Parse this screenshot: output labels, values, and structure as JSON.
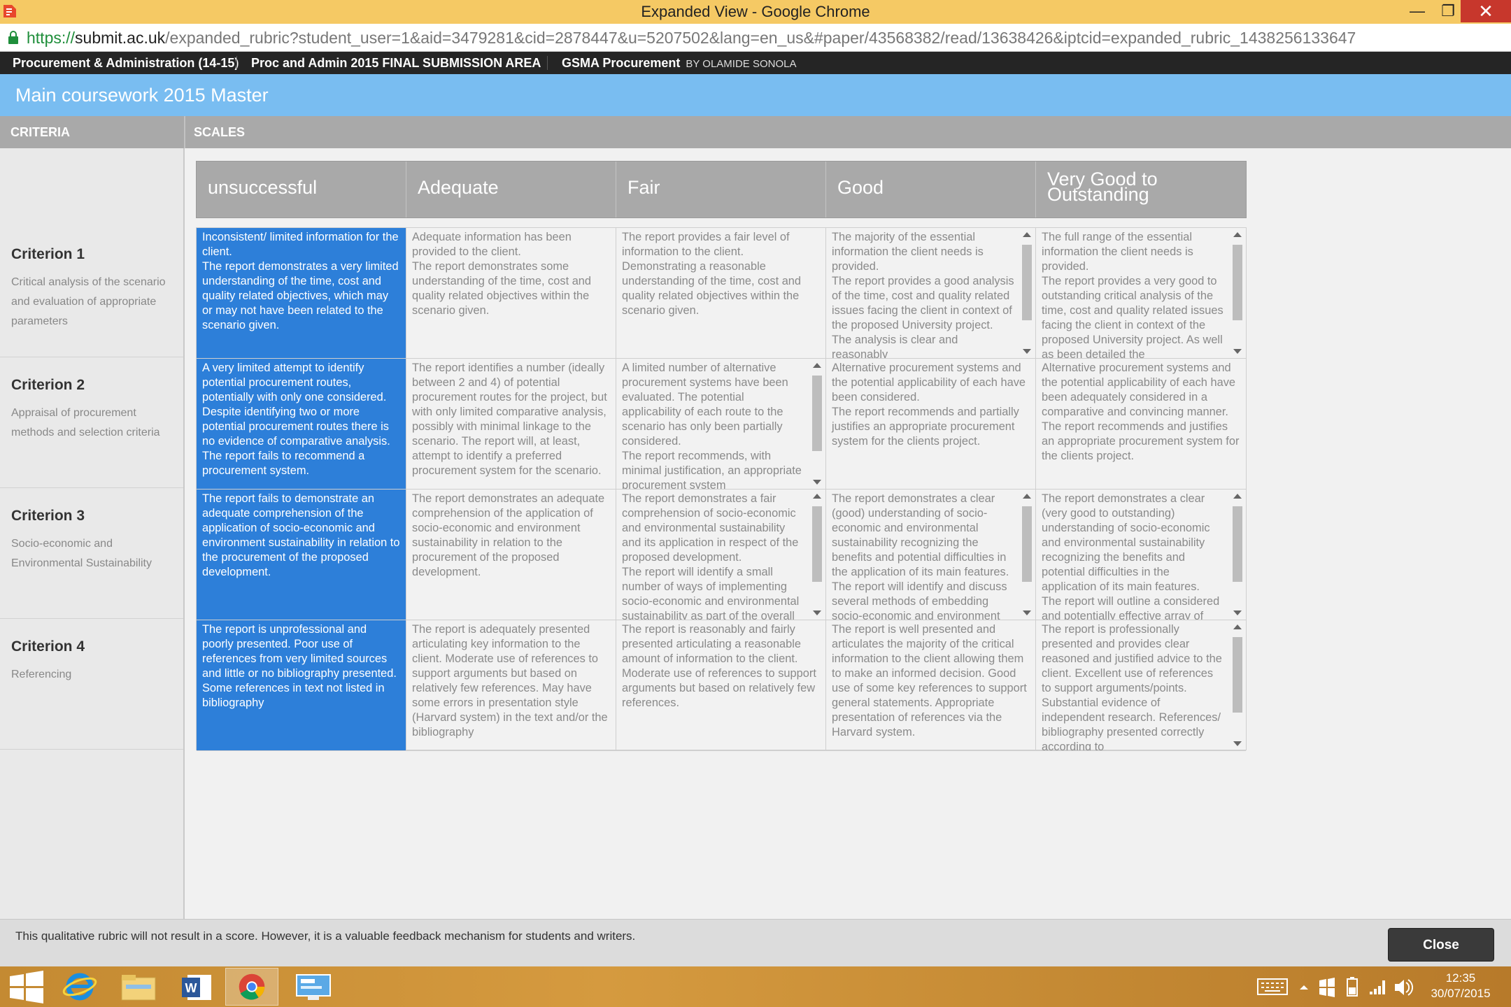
{
  "window": {
    "title": "Expanded View - Google Chrome",
    "minimize": "—",
    "maximize": "❐",
    "close": "✕"
  },
  "address": {
    "scheme": "https://",
    "host": "submit.ac.uk",
    "path": "/expanded_rubric?student_user=1&aid=3479281&cid=2878447&u=5207502&lang=en_us&#paper/43568382/read/13638426&iptcid=expanded_rubric_1438256133647"
  },
  "breadcrumb": {
    "items": [
      "Procurement & Administration (14-15)",
      "Proc and Admin 2015 FINAL SUBMISSION AREA",
      "GSMA Procurement"
    ],
    "by": "BY OLAMIDE SONOLA"
  },
  "page": {
    "title": "Main coursework 2015 Master"
  },
  "columns": {
    "criteria": "CRITERIA",
    "scales": "SCALES"
  },
  "scales": [
    "unsuccessful",
    "Adequate",
    "Fair",
    "Good",
    "Very Good to Outstanding"
  ],
  "criteria": [
    {
      "title": "Criterion 1",
      "description": "Critical analysis of the scenario and evaluation of appropriate parameters",
      "cells": [
        "Inconsistent/ limited information for the client.\nThe report demonstrates a very limited understanding of the time, cost and quality related objectives, which may or may not have been related to the scenario given.",
        "Adequate information has been provided to the client.\nThe report demonstrates some understanding of the time, cost and quality related objectives within the scenario given.",
        "The report provides a fair level of information to the client.\nDemonstrating a reasonable understanding of the time, cost and quality related objectives within the scenario given.",
        "The majority of the essential information the client needs is provided.\nThe report provides a good analysis of the time, cost and quality related issues facing the client in context of the proposed University project. The analysis is clear and reasonably",
        "The full range of the essential information the client needs is provided.\nThe report provides a very good to outstanding critical analysis of the time, cost and quality related issues facing the client in context of the proposed University project. As well as been detailed the"
      ]
    },
    {
      "title": "Criterion 2",
      "description": "Appraisal of procurement methods and selection criteria",
      "cells": [
        "A very limited attempt to identify potential procurement routes, potentially with only one considered. Despite identifying two or more potential procurement routes there is no evidence of comparative analysis. The report fails to recommend a procurement system.",
        "The report identifies a number (ideally between 2 and 4) of potential procurement routes for the project, but with only limited comparative analysis, possibly with minimal linkage to the scenario. The report will, at least, attempt to identify a preferred procurement system for the scenario.",
        "A limited number of alternative procurement systems have been evaluated. The potential applicability of each route to the scenario has only been partially considered.\nThe report recommends, with minimal justification, an appropriate procurement system",
        "Alternative procurement systems and the potential applicability of each have been considered.\nThe report recommends and partially justifies an appropriate procurement system for the clients project.",
        "Alternative procurement systems and the potential applicability of each have been adequately considered in a comparative and convincing manner.\nThe report recommends and justifies an appropriate procurement system for the clients project."
      ]
    },
    {
      "title": "Criterion 3",
      "description": "Socio-economic and Environmental Sustainability",
      "cells": [
        "The report fails to demonstrate an adequate comprehension of the application of socio-economic and environment sustainability in relation to the procurement of the proposed development.",
        "The report demonstrates an adequate comprehension of the application of socio-economic and environment sustainability in relation to the procurement of the proposed development.",
        "The report demonstrates a fair comprehension of socio-economic and environmental sustainability and its application in respect of the proposed development.\nThe report will identify a small number of ways of implementing socio-economic and environmental sustainability as part of the overall",
        "The report demonstrates a clear (good) understanding of socio-economic and environmental sustainability recognizing the benefits and potential difficulties in the application of its main features. The report will identify and discuss several methods of embedding socio-economic and environment",
        "The report demonstrates a clear (very good to outstanding) understanding of socio-economic and environmental sustainability recognizing the benefits and potential difficulties in the application of its main features.\nThe report will outline a considered and potentially effective array of"
      ]
    },
    {
      "title": "Criterion 4",
      "description": "Referencing",
      "cells": [
        "The report is unprofessional and poorly presented. Poor use of references from very limited sources and little or no bibliography presented. Some references in text not listed in bibliography",
        "The report is adequately presented articulating key information to the client. Moderate use of references to support arguments but based on relatively few references. May have some errors in presentation style (Harvard system) in the text and/or the bibliography",
        "The report is reasonably and fairly presented articulating a reasonable amount of information to the client. Moderate use of references to support arguments but based on relatively few references.",
        "The report is well presented and articulates the majority of the critical information to the client allowing them to make an informed decision. Good use of some key references to support general statements. Appropriate presentation of references via the Harvard system.",
        "The report is professionally presented and provides clear reasoned and justified advice to the client. Excellent use of references to support arguments/points. Substantial evidence of independent research. References/ bibliography presented correctly according to"
      ]
    }
  ],
  "footer": {
    "note": "This qualitative rubric will not result in a score. However, it is a valuable feedback mechanism for students and writers.",
    "close_label": "Close"
  },
  "taskbar": {
    "apps": [
      "windows-start",
      "internet-explorer",
      "file-explorer",
      "word",
      "chrome",
      "remote-desktop"
    ],
    "time": "12:35",
    "date": "30/07/2015"
  },
  "colors": {
    "titlebar": "#f5c964",
    "header_blue": "#79bdf1",
    "selected_blue": "#2d7fd9",
    "scale_gray": "#a9a9a9",
    "dark_bar": "#252525"
  }
}
